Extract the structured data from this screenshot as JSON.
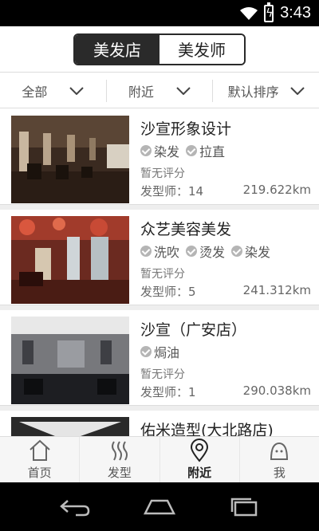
{
  "status_bar": {
    "time": "3:43"
  },
  "segment": {
    "shops_label": "美发店",
    "stylists_label": "美发师"
  },
  "filters": [
    {
      "label": "全部"
    },
    {
      "label": "附近"
    },
    {
      "label": "默认排序"
    }
  ],
  "shops": [
    {
      "name": "沙宣形象设计",
      "tags": [
        "染发",
        "拉直"
      ],
      "rating": "暂无评分",
      "stylists": "发型师：14",
      "distance": "219.622km"
    },
    {
      "name": "众艺美容美发",
      "tags": [
        "洗吹",
        "烫发",
        "染发"
      ],
      "rating": "暂无评分",
      "stylists": "发型师：5",
      "distance": "241.312km"
    },
    {
      "name": "沙宣（广安店）",
      "tags": [
        "焗油"
      ],
      "rating": "暂无评分",
      "stylists": "发型师：1",
      "distance": "290.038km"
    },
    {
      "name": "佑米造型(大北路店)",
      "tags": [],
      "rating": "",
      "stylists": "",
      "distance": ""
    }
  ],
  "tabs": [
    {
      "label": "首页",
      "icon": "home-icon"
    },
    {
      "label": "发型",
      "icon": "hair-icon"
    },
    {
      "label": "附近",
      "icon": "location-pin-icon"
    },
    {
      "label": "我",
      "icon": "profile-icon"
    }
  ],
  "nav_buttons": [
    "back-icon",
    "home-icon",
    "recent-apps-icon"
  ]
}
